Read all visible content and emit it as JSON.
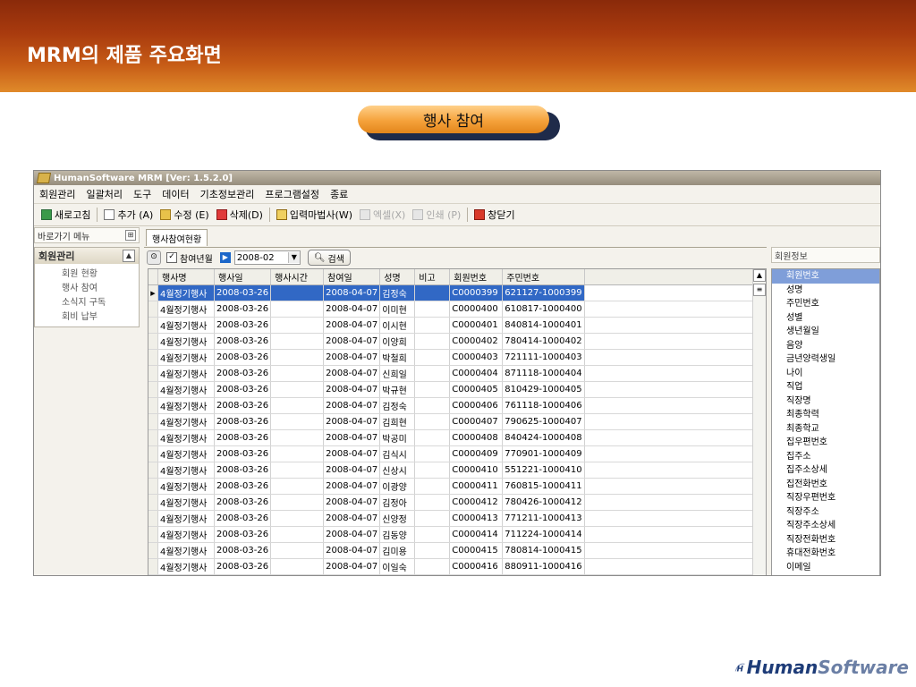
{
  "slide": {
    "title": "MRM의 제품 주요화면",
    "section_badge": "행사 참여"
  },
  "window": {
    "title": "HumanSoftware MRM [Ver: 1.5.2.0]"
  },
  "menubar": [
    "회원관리",
    "일괄처리",
    "도구",
    "데이터",
    "기초정보관리",
    "프로그램설정",
    "종료"
  ],
  "toolbar": {
    "refresh": "새로고침",
    "add": "추가 (A)",
    "edit": "수정 (E)",
    "delete": "삭제(D)",
    "wizard": "입력마법사(W)",
    "excel": "엑셀(X)",
    "print": "인쇄 (P)",
    "close": "창닫기"
  },
  "left_panel": {
    "header": "바로가기 메뉴",
    "group_title": "회원관리",
    "items": [
      "회원 현황",
      "행사 참여",
      "소식지 구독",
      "회비 납부"
    ]
  },
  "main": {
    "tab": "행사참여현황",
    "filter": {
      "checkbox_label": "참여년월",
      "month_value": "2008-02",
      "search_button": "검색"
    },
    "columns": [
      "행사명",
      "행사일",
      "행사시간",
      "참여일",
      "성명",
      "비고",
      "회원번호",
      "주민번호"
    ],
    "rows": [
      [
        "4월정기행사",
        "2008-03-26",
        "",
        "2008-04-07",
        "김정숙",
        "",
        "C0000399",
        "621127-1000399"
      ],
      [
        "4월정기행사",
        "2008-03-26",
        "",
        "2008-04-07",
        "이미현",
        "",
        "C0000400",
        "610817-1000400"
      ],
      [
        "4월정기행사",
        "2008-03-26",
        "",
        "2008-04-07",
        "이시현",
        "",
        "C0000401",
        "840814-1000401"
      ],
      [
        "4월정기행사",
        "2008-03-26",
        "",
        "2008-04-07",
        "이양희",
        "",
        "C0000402",
        "780414-1000402"
      ],
      [
        "4월정기행사",
        "2008-03-26",
        "",
        "2008-04-07",
        "박철희",
        "",
        "C0000403",
        "721111-1000403"
      ],
      [
        "4월정기행사",
        "2008-03-26",
        "",
        "2008-04-07",
        "신희일",
        "",
        "C0000404",
        "871118-1000404"
      ],
      [
        "4월정기행사",
        "2008-03-26",
        "",
        "2008-04-07",
        "박규현",
        "",
        "C0000405",
        "810429-1000405"
      ],
      [
        "4월정기행사",
        "2008-03-26",
        "",
        "2008-04-07",
        "김정숙",
        "",
        "C0000406",
        "761118-1000406"
      ],
      [
        "4월정기행사",
        "2008-03-26",
        "",
        "2008-04-07",
        "김희현",
        "",
        "C0000407",
        "790625-1000407"
      ],
      [
        "4월정기행사",
        "2008-03-26",
        "",
        "2008-04-07",
        "박공미",
        "",
        "C0000408",
        "840424-1000408"
      ],
      [
        "4월정기행사",
        "2008-03-26",
        "",
        "2008-04-07",
        "김식시",
        "",
        "C0000409",
        "770901-1000409"
      ],
      [
        "4월정기행사",
        "2008-03-26",
        "",
        "2008-04-07",
        "신상시",
        "",
        "C0000410",
        "551221-1000410"
      ],
      [
        "4월정기행사",
        "2008-03-26",
        "",
        "2008-04-07",
        "이광양",
        "",
        "C0000411",
        "760815-1000411"
      ],
      [
        "4월정기행사",
        "2008-03-26",
        "",
        "2008-04-07",
        "김정아",
        "",
        "C0000412",
        "780426-1000412"
      ],
      [
        "4월정기행사",
        "2008-03-26",
        "",
        "2008-04-07",
        "신양정",
        "",
        "C0000413",
        "771211-1000413"
      ],
      [
        "4월정기행사",
        "2008-03-26",
        "",
        "2008-04-07",
        "김동양",
        "",
        "C0000414",
        "711224-1000414"
      ],
      [
        "4월정기행사",
        "2008-03-26",
        "",
        "2008-04-07",
        "김미용",
        "",
        "C0000415",
        "780814-1000415"
      ],
      [
        "4월정기행사",
        "2008-03-26",
        "",
        "2008-04-07",
        "이일숙",
        "",
        "C0000416",
        "880911-1000416"
      ]
    ]
  },
  "right_panel": {
    "header": "회원정보",
    "fields": [
      "회원번호",
      "성명",
      "주민번호",
      "성별",
      "생년월일",
      "음양",
      "금년양력생일",
      "나이",
      "직업",
      "직장명",
      "최종학력",
      "최종학교",
      "집우편번호",
      "집주소",
      "집주소상세",
      "집전화번호",
      "직장우편번호",
      "직장주소",
      "직장주소상세",
      "직장전화번호",
      "휴대전화번호",
      "이메일"
    ]
  },
  "footer": {
    "logo_part1": "Human",
    "logo_part2": "Software"
  },
  "colors": {
    "banner": "#a83a0e",
    "selection": "#3168c5",
    "badge": "#f5a23b"
  }
}
